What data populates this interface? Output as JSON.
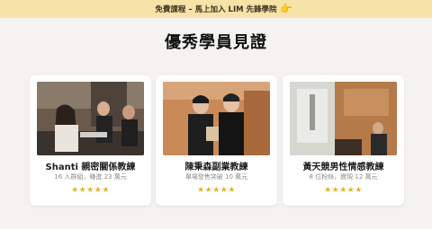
{
  "banner": {
    "text": "免費課程 – 馬上加入 LIM 先鋒學院",
    "icon": "pointing-hand-icon",
    "icon_glyph": "👉"
  },
  "title": "優秀學員見證",
  "colors": {
    "banner_bg": "#f7e3a8",
    "star": "#e6b423",
    "page_bg": "#f4f3f1"
  },
  "cards": [
    {
      "name": "Shanti 親密關係教練",
      "meta": "16 人群組，賺進 23 萬元",
      "stars": "★★★★★"
    },
    {
      "name": "陳秉森副業教練",
      "meta": "單場發售突破 10 萬元",
      "stars": "★★★★★"
    },
    {
      "name": "黃天競男性情感教練",
      "meta": "8 位粉絲，變現 12 萬元",
      "stars": "★★★★★"
    }
  ]
}
